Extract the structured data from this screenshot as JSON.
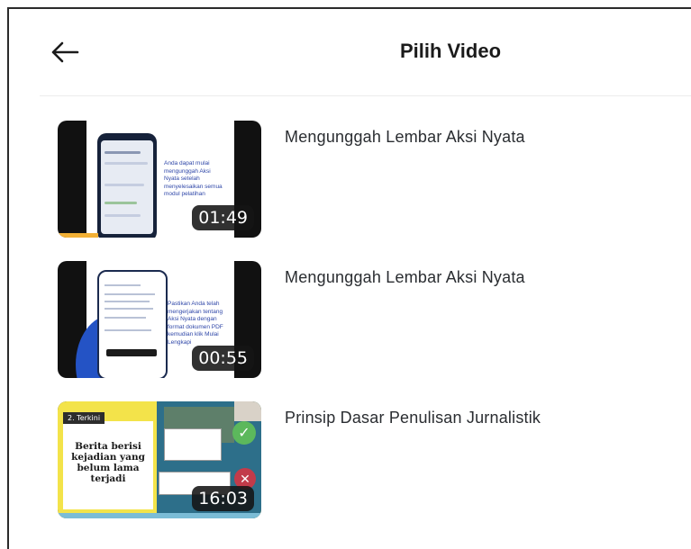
{
  "header": {
    "title": "Pilih Video",
    "back_icon": "arrow-left-icon"
  },
  "videos": [
    {
      "title": "Mengunggah Lembar Aksi Nyata",
      "duration": "01:49",
      "thumb_text": "Anda dapat mulai mengunggah Aksi Nyata setelah menyelesaikan semua modul pelatihan",
      "watched_fraction": 0.2
    },
    {
      "title": "Mengunggah Lembar Aksi Nyata",
      "duration": "00:55",
      "thumb_text": "Pastikan Anda telah mengerjakan tentang Aksi Nyata dengan format dokumen PDF kemudian klik Mulai Lengkapi",
      "watched_fraction": 0
    },
    {
      "title": "Prinsip Dasar Penulisan Jurnalistik",
      "duration": "16:03",
      "thumb_tag": "2. Terkini",
      "thumb_quote": "Berita berisi kejadian yang belum lama terjadi",
      "watched_fraction": 0
    }
  ],
  "colors": {
    "progress": "#f2b035",
    "duration_bg": "#141414"
  }
}
